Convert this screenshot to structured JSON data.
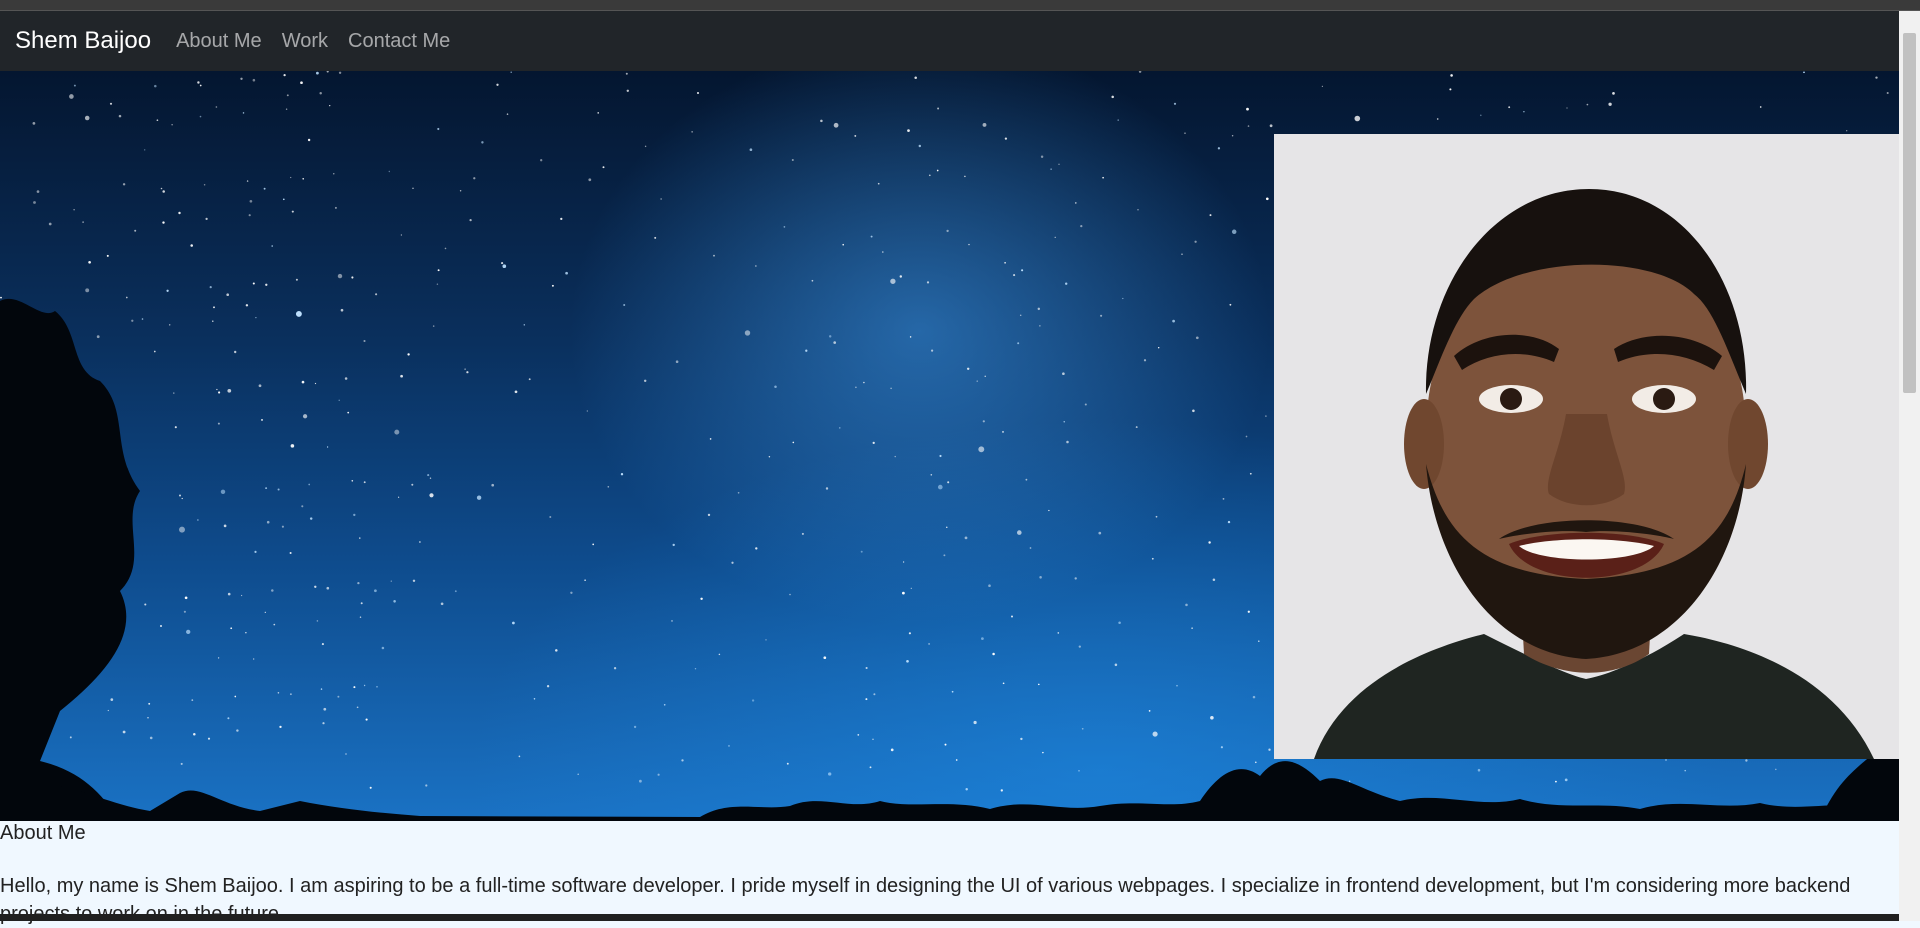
{
  "navbar": {
    "brand": "Shem Baijoo",
    "links": [
      {
        "label": "About Me"
      },
      {
        "label": "Work"
      },
      {
        "label": "Contact Me"
      }
    ]
  },
  "hero": {
    "background": "night-sky-milky-way-image",
    "portrait": "profile-photo"
  },
  "about": {
    "heading": "About Me",
    "text": "Hello, my name is Shem Baijoo. I am aspiring to be a full-time software developer. I pride myself in designing the UI of various webpages. I specialize in frontend development, but I'm considering more backend projects to work on in the future."
  },
  "colors": {
    "navbar": "#212529",
    "content_bg": "#f0f8ff",
    "sky": "#0e4b8c"
  }
}
